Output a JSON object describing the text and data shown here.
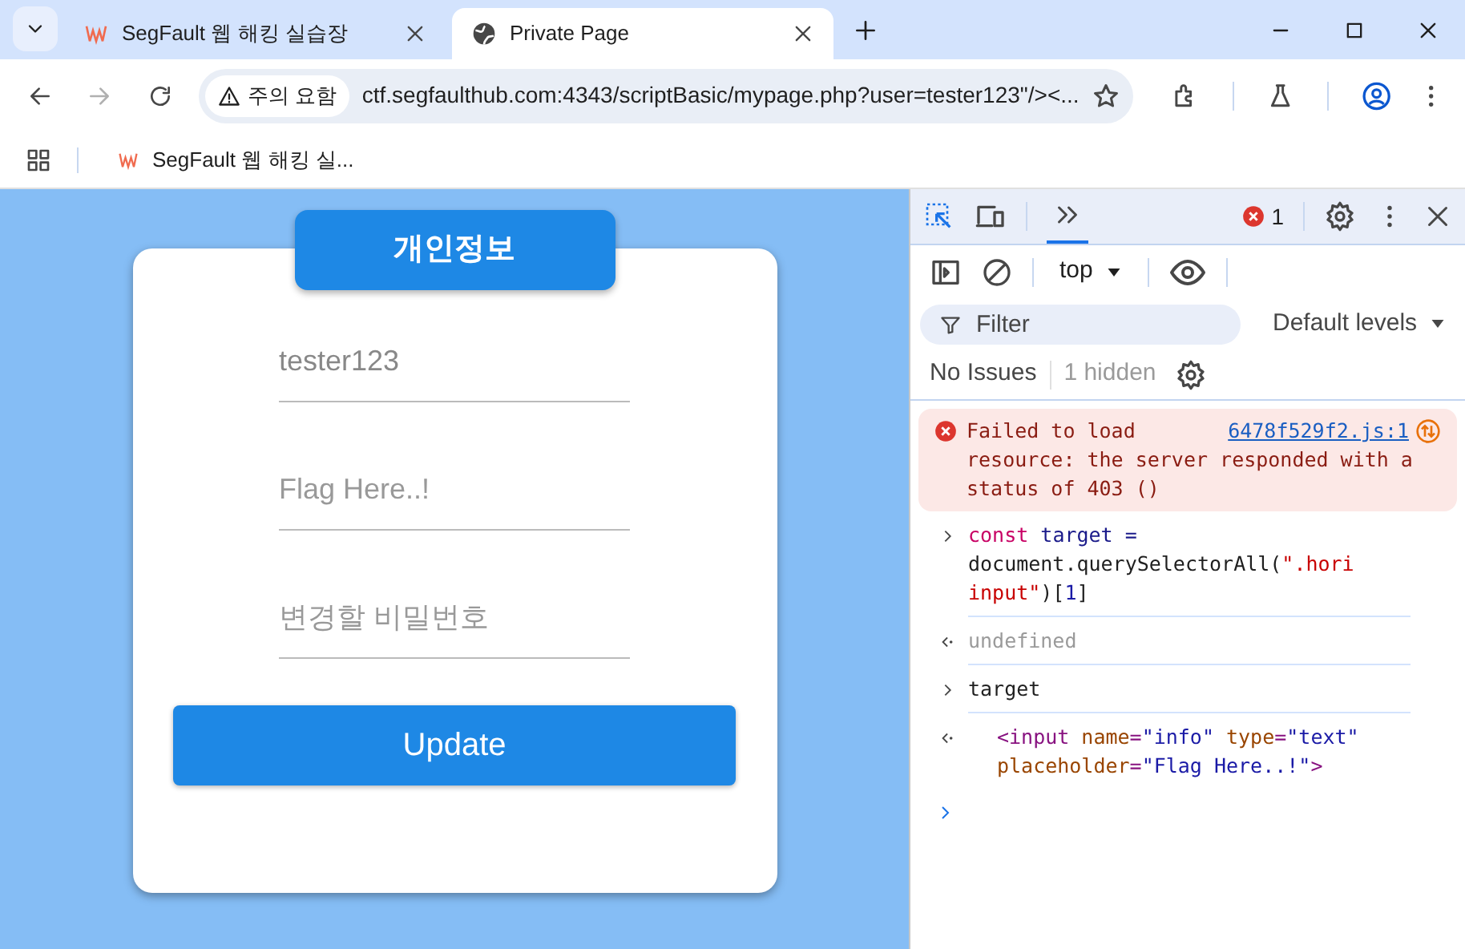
{
  "browser": {
    "tabs": [
      {
        "title": "SegFault 웹 해킹 실습장",
        "selected": false
      },
      {
        "title": "Private Page",
        "selected": true
      }
    ],
    "warning": "주의 요함",
    "url": "ctf.segfaulthub.com:4343/scriptBasic/mypage.php?user=tester123\"/><...",
    "bookmarks": [
      {
        "title": "SegFault 웹 해킹 실..."
      }
    ]
  },
  "page": {
    "heading": "개인정보",
    "fields": [
      {
        "value": "tester123"
      },
      {
        "placeholder": "Flag Here..!"
      },
      {
        "placeholder": "변경할 비밀번호"
      }
    ],
    "button": "Update"
  },
  "devtools": {
    "error_count": "1",
    "context": "top",
    "filter_placeholder": "Filter",
    "levels": "Default levels",
    "issues": "No Issues",
    "hidden": "1 hidden",
    "entries": [
      {
        "kind": "error",
        "message": "Failed to load resource: the server responded with a status of 403 ()",
        "source": "6478f529f2.js:1"
      },
      {
        "kind": "input",
        "tokens": [
          {
            "text": "const",
            "kind": "keyword"
          },
          {
            "text": " target =",
            "kind": "variable"
          },
          {
            "text": " document.querySelectorAll(",
            "kind": "plain"
          },
          {
            "text": "\".hori input\"",
            "kind": "string"
          },
          {
            "text": ")[",
            "kind": "plain"
          },
          {
            "text": "1",
            "kind": "number"
          },
          {
            "text": "]",
            "kind": "plain"
          }
        ]
      },
      {
        "kind": "result",
        "tokens": [
          {
            "text": "undefined",
            "kind": "muted"
          }
        ]
      },
      {
        "kind": "input",
        "tokens": [
          {
            "text": "target",
            "kind": "plain"
          }
        ]
      },
      {
        "kind": "element",
        "tokens": [
          {
            "text": "<input",
            "kind": "tag"
          },
          {
            "text": " name",
            "kind": "attr"
          },
          {
            "text": "=",
            "kind": "tag"
          },
          {
            "text": "\"info\"",
            "kind": "value"
          },
          {
            "text": " type",
            "kind": "attr"
          },
          {
            "text": "=",
            "kind": "tag"
          },
          {
            "text": "\"text\"",
            "kind": "value"
          },
          {
            "text": " placeholder",
            "kind": "attr"
          },
          {
            "text": "=",
            "kind": "tag"
          },
          {
            "text": "\"Flag Here..!\"",
            "kind": "value"
          },
          {
            "text": ">",
            "kind": "tag"
          }
        ]
      }
    ]
  }
}
